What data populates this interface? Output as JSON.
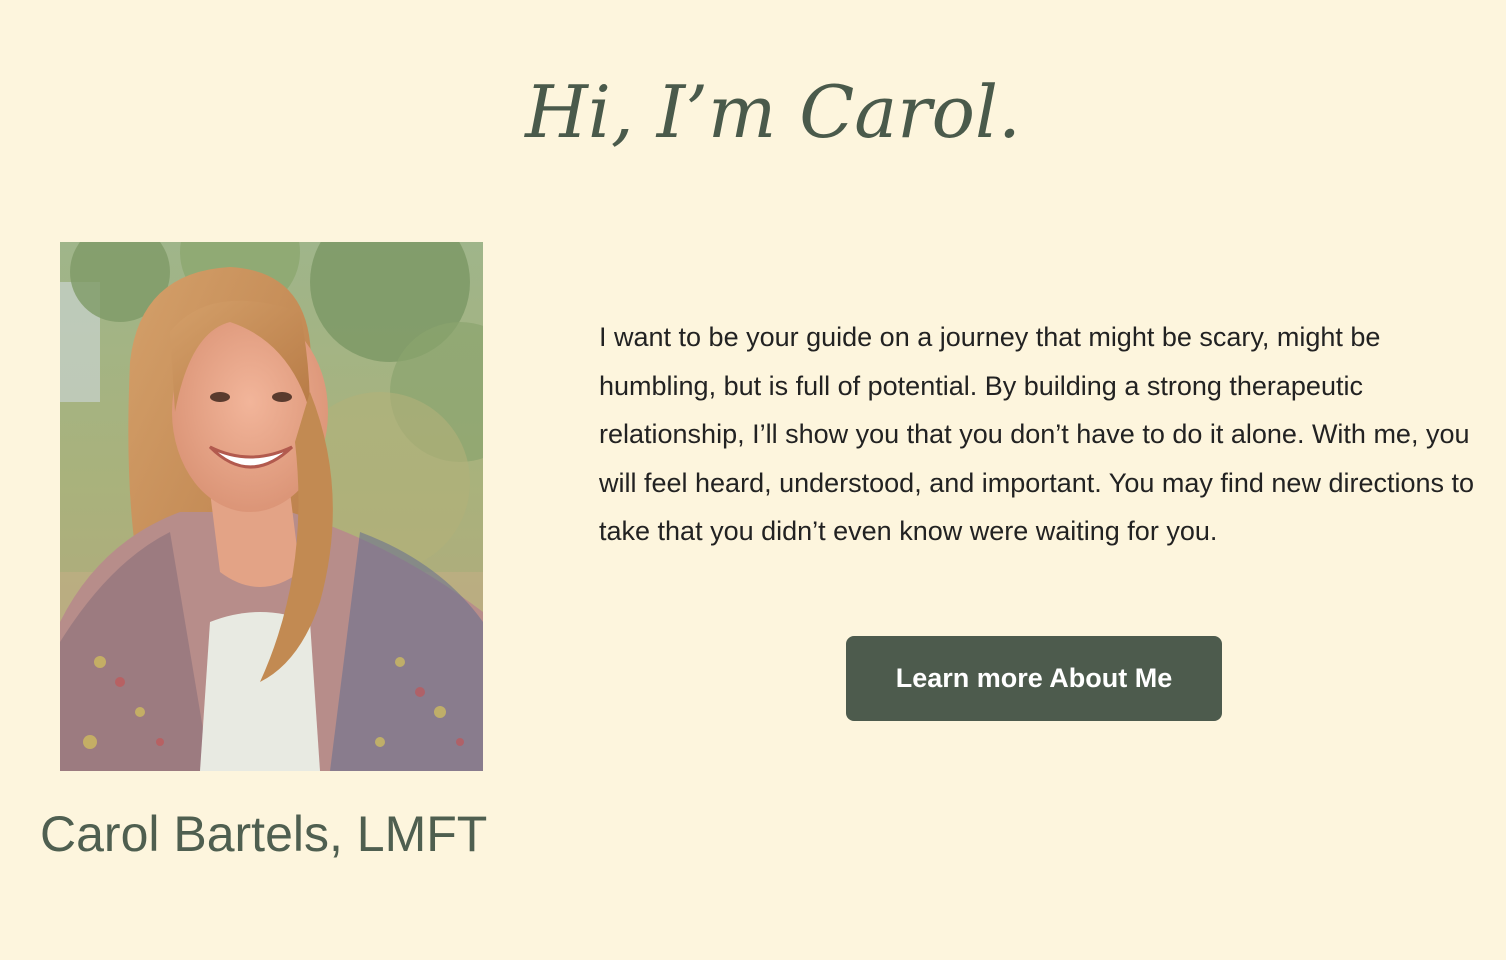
{
  "intro": {
    "heading": "Hi, I’m Carol.",
    "photo_alt": "portrait-photo",
    "name": "Carol Bartels, LMFT",
    "bio": "I want to be your guide on a journey that might be scary, might be humbling, but is full of potential. By building a strong therapeutic relationship, I’ll show you that you don’t have to do it alone. With me, you will feel heard, understood, and important. You may find new directions to take that you didn’t even know were waiting for you.",
    "cta_label": "Learn more About Me"
  },
  "colors": {
    "background": "#fdf5dd",
    "heading": "#4a5a4b",
    "button": "#4d5b4d",
    "button_text": "#ffffff",
    "body_text": "#222222"
  }
}
